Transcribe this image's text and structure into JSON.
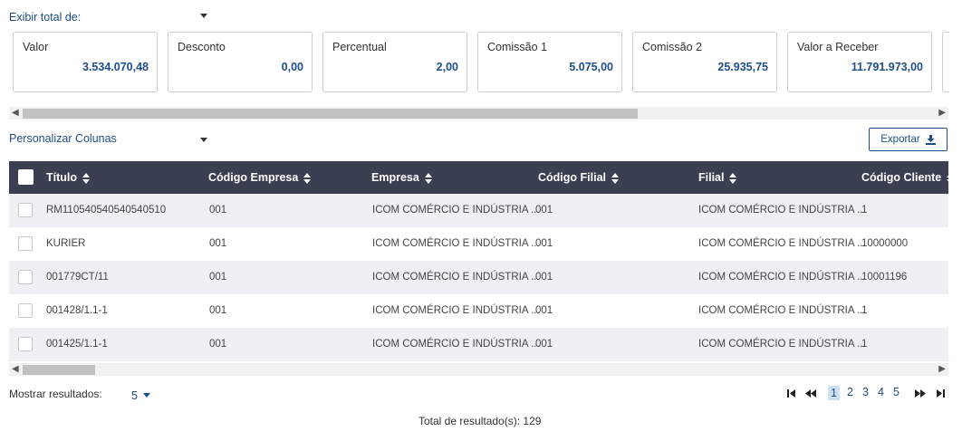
{
  "summary": {
    "label": "Exibir total de:",
    "cards": [
      {
        "label": "Valor",
        "value": "3.534.070,48"
      },
      {
        "label": "Desconto",
        "value": "0,00"
      },
      {
        "label": "Percentual",
        "value": "2,00"
      },
      {
        "label": "Comissão 1",
        "value": "5.075,00"
      },
      {
        "label": "Comissão 2",
        "value": "25.935,75"
      },
      {
        "label": "Valor a Receber",
        "value": "11.791.973,00"
      }
    ]
  },
  "columns_selector": {
    "label": "Personalizar Colunas"
  },
  "export_button": {
    "label": "Exportar"
  },
  "table": {
    "headers": [
      "Título",
      "Código Empresa",
      "Empresa",
      "Código Filial",
      "Filial",
      "Código Cliente"
    ],
    "rows": [
      [
        "RM110540540540540510",
        "001",
        "ICOM COMÉRCIO E INDÚSTRIA ...",
        "001",
        "ICOM COMÉRCIO E INDÚSTRIA ...",
        "1"
      ],
      [
        "KURIER",
        "001",
        "ICOM COMÉRCIO E INDÚSTRIA ...",
        "001",
        "ICOM COMÉRCIO E INDÚSTRIA ...",
        "10000000"
      ],
      [
        "001779CT/11",
        "001",
        "ICOM COMÉRCIO E INDÚSTRIA ...",
        "001",
        "ICOM COMÉRCIO E INDÚSTRIA ...",
        "10001196"
      ],
      [
        "001428/1.1-1",
        "001",
        "ICOM COMÉRCIO E INDÚSTRIA ...",
        "001",
        "ICOM COMÉRCIO E INDÚSTRIA ...",
        "1"
      ],
      [
        "001425/1.1-1",
        "001",
        "ICOM COMÉRCIO E INDÚSTRIA ...",
        "001",
        "ICOM COMÉRCIO E INDÚSTRIA ...",
        "1"
      ]
    ]
  },
  "pagination": {
    "show_label": "Mostrar resultados:",
    "page_size": "5",
    "pages": [
      "1",
      "2",
      "3",
      "4",
      "5"
    ],
    "current_page": "1",
    "total_text": "Total de resultado(s): 129"
  },
  "colors": {
    "accent": "#1d4e89",
    "header_bg": "#3a3f51",
    "row_alt": "#efeff4"
  }
}
